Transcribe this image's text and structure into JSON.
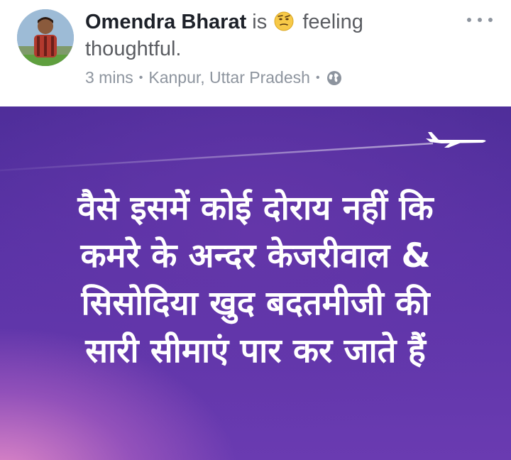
{
  "post": {
    "author_name": "Omendra Bharat",
    "is_text": "is",
    "feeling_text": "feeling",
    "feeling_value": "thoughtful.",
    "time": "3 mins",
    "location": "Kanpur, Uttar Pradesh",
    "privacy_icon": "globe-icon",
    "feeling_icon": "thinking-face-emoji"
  },
  "image": {
    "lines": [
      "वैसे इसमें कोई दोराय नहीं कि",
      "कमरे के अन्दर केजरीवाल &",
      "सिसोदिया खुद बदतमीजी की",
      "सारी सीमाएं पार कर जाते हैं"
    ],
    "colors": {
      "background": "#5a33a6",
      "text": "#ffffff",
      "glow": "#e68cc8"
    }
  },
  "colors": {
    "author": "#1d2129",
    "secondary": "#8d949e",
    "body": "#5a5c61"
  }
}
